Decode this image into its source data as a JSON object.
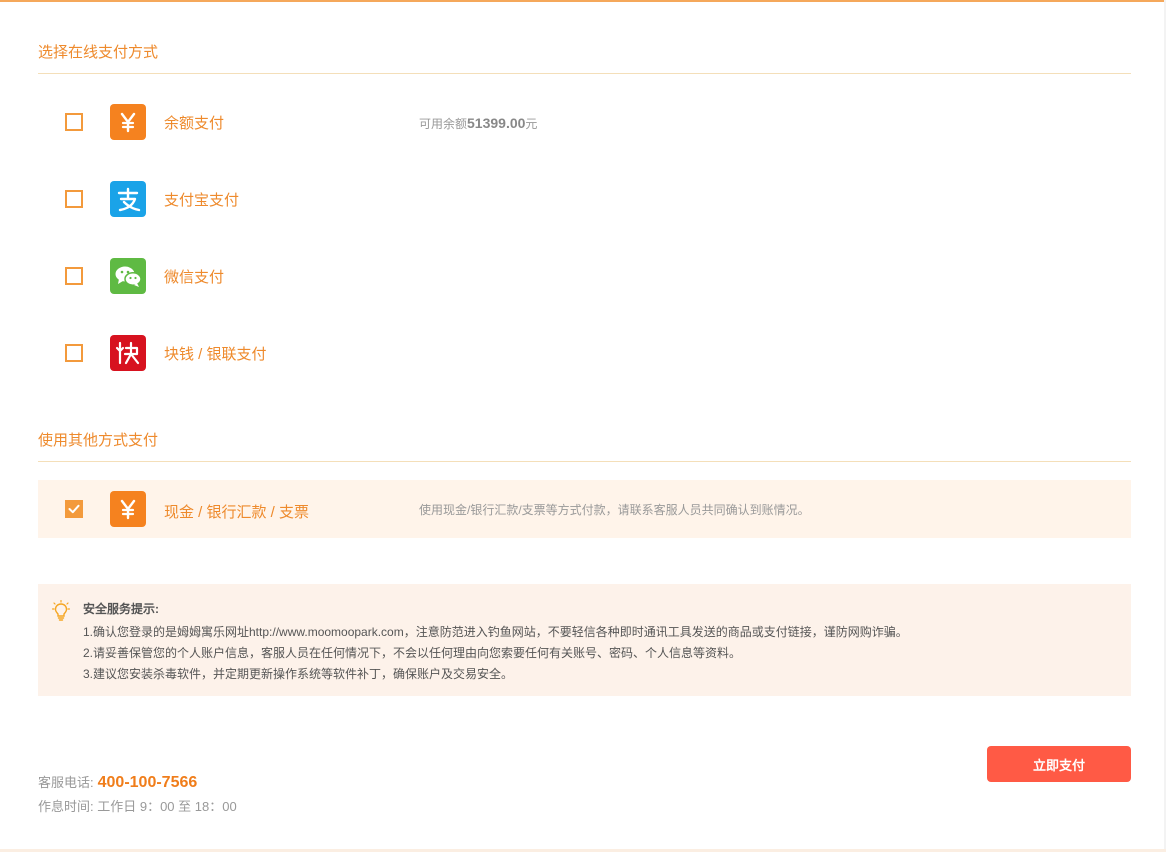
{
  "online_section": {
    "title": "选择在线支付方式",
    "methods": [
      {
        "label": "余额支付",
        "icon": "yen-icon",
        "icon_color": "#f5821f",
        "note_prefix": "可用余额",
        "note_amount": "51399.00",
        "note_suffix": "元",
        "checked": false
      },
      {
        "label": "支付宝支付",
        "icon": "alipay-icon",
        "icon_color": "#1aa3e8",
        "checked": false
      },
      {
        "label": "微信支付",
        "icon": "wechat-icon",
        "icon_color": "#5fba43",
        "checked": false
      },
      {
        "label": "块钱 / 银联支付",
        "icon": "kuaiqian-icon",
        "icon_color": "#d7121f",
        "checked": false
      }
    ]
  },
  "other_section": {
    "title": "使用其他方式支付",
    "method": {
      "label": "现金 / 银行汇款 / 支票",
      "icon": "yen-icon",
      "icon_color": "#f5821f",
      "note": "使用现金/银行汇款/支票等方式付款，请联系客服人员共同确认到账情况。",
      "checked": true
    }
  },
  "notice": {
    "title": "安全服务提示:",
    "lines": [
      "1.确认您登录的是姆姆寓乐网址http://www.moomoopark.com，注意防范进入钓鱼网站，不要轻信各种即时通讯工具发送的商品或支付链接，谨防网购诈骗。",
      "2.请妥善保管您的个人账户信息，客服人员在任何情况下，不会以任何理由向您索要任何有关账号、密码、个人信息等资料。",
      "3.建议您安装杀毒软件，并定期更新操作系统等软件补丁，确保账户及交易安全。"
    ],
    "icon": "lightbulb-icon"
  },
  "footer": {
    "phone_label": "客服电话:",
    "phone": "400-100-7566",
    "hours": "作息时间: 工作日 9：00 至 18：00"
  },
  "pay_button": {
    "label": "立即支付",
    "color": "#ff5a45"
  },
  "accent_color": "#ee8a2c"
}
